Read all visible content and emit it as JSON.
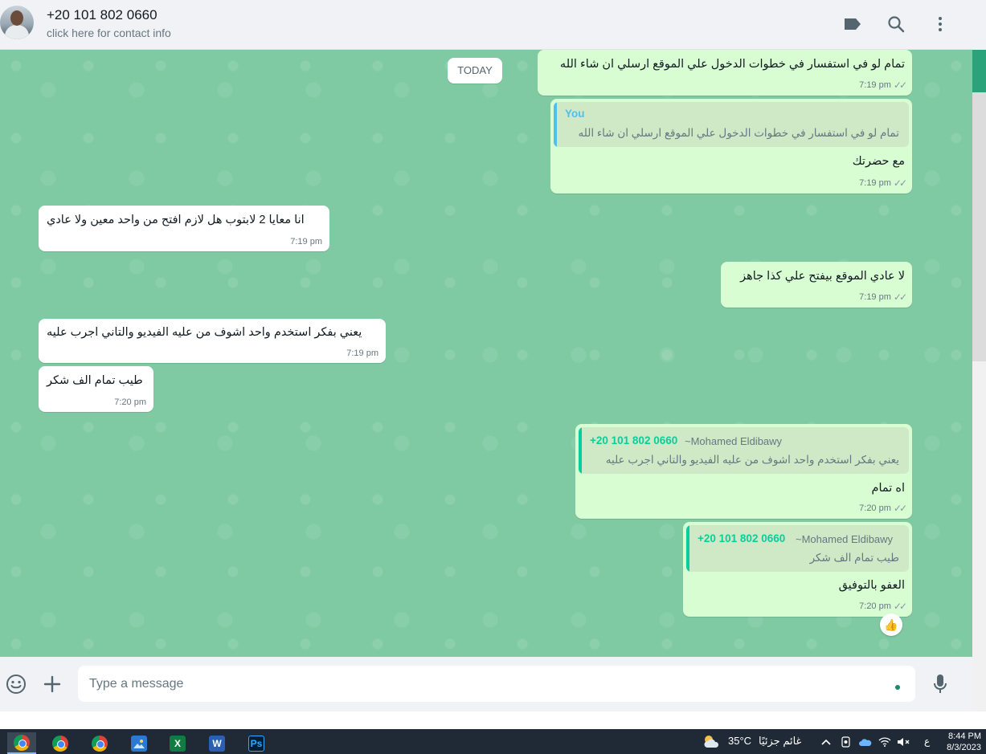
{
  "header": {
    "contact_name": "+20 101 802 0660",
    "contact_sub": "click here for contact info",
    "icons": [
      "label-icon",
      "search-icon",
      "menu-icon"
    ]
  },
  "chat": {
    "date_chip": "TODAY",
    "messages": [
      {
        "dir": "out",
        "text": "تمام لو في استفسار في خطوات الدخول علي الموقع ارسلي ان شاء الله",
        "time": "7:19 pm"
      },
      {
        "dir": "out",
        "quote_author": "You",
        "quote_text": "تمام لو في استفسار في خطوات الدخول علي الموقع ارسلي ان شاء الله",
        "text": "مع حضرتك",
        "time": "7:19 pm"
      },
      {
        "dir": "in",
        "text": "انا معايا 2 لابتوب هل لازم افتح من واحد معين ولا عادي",
        "time": "7:19 pm"
      },
      {
        "dir": "out",
        "text": "لا عادي الموقع بيفتح علي كذا جاهز",
        "time": "7:19 pm"
      },
      {
        "dir": "in",
        "text": "يعني بفكر استخدم واحد اشوف من عليه الفيديو والتاني اجرب عليه",
        "time": "7:19 pm"
      },
      {
        "dir": "in",
        "text": "طيب تمام الف شكر",
        "time": "7:20 pm"
      },
      {
        "dir": "out",
        "quote_author": "+20 101 802 0660",
        "quote_alias": "~Mohamed Eldibawy",
        "quote_text": "يعني بفكر استخدم واحد اشوف من عليه الفيديو والتاني اجرب عليه",
        "text": "اه تمام",
        "time": "7:20 pm"
      },
      {
        "dir": "out",
        "quote_author": "+20 101 802 0660",
        "quote_alias": "~Mohamed Eldibawy",
        "quote_text": "طيب تمام الف شكر",
        "text": "العفو بالتوفيق",
        "time": "7:20 pm",
        "reaction": "👍"
      }
    ]
  },
  "composer": {
    "placeholder": "Type a message",
    "icons": [
      "emoji-icon",
      "plus-icon",
      "mic-icon"
    ]
  },
  "taskbar": {
    "apps": [
      "chrome-icon",
      "chrome-icon",
      "chrome-icon",
      "photos-icon",
      "excel-icon",
      "word-icon",
      "photoshop-icon"
    ],
    "excel_letter": "X",
    "word_letter": "W",
    "ps_letters": "Ps",
    "temperature": "35°C",
    "weather_text": "غائم جزئيًا",
    "lang": "ع",
    "time": "8:44 PM",
    "date": "8/3/2023"
  },
  "colors": {
    "chat_bg": "#7fcaa3",
    "out_bubble": "#d9fdd3",
    "in_bubble": "#ffffff",
    "quote_you_bar": "#53bdeb",
    "quote_contact_bar": "#06cf9c",
    "taskbar": "#1f2a36"
  }
}
